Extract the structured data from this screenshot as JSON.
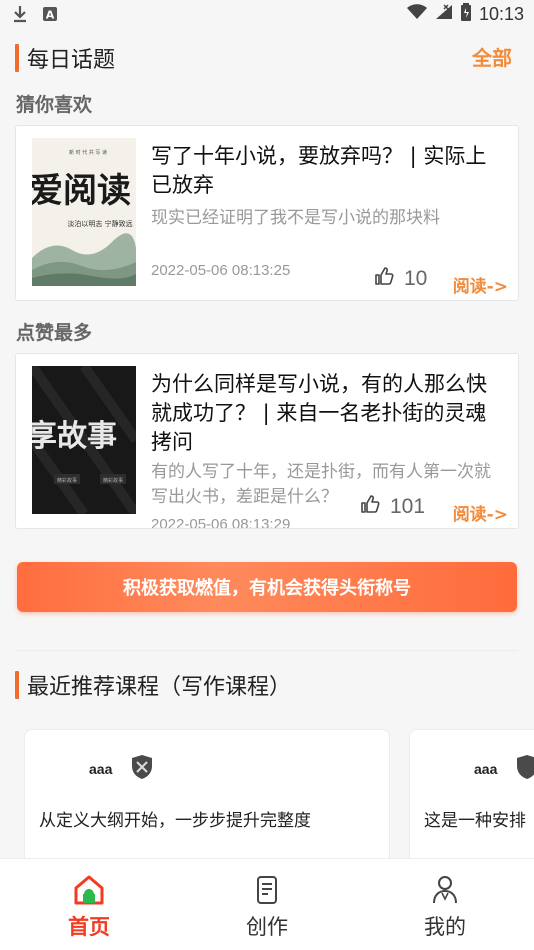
{
  "status_bar": {
    "time": "10:13"
  },
  "daily": {
    "title": "每日话题",
    "more_label": "全部"
  },
  "guess": {
    "label": "猜你喜欢",
    "title": "写了十年小说，要放弃吗？ | 实际上已放弃",
    "summary": "现实已经证明了我不是写小说的那块料",
    "date": "2022-05-06 08:13:25",
    "likes": "10",
    "read_label": "阅读->",
    "thumb": {
      "big_text": "爱阅读",
      "top_text": "新 时 代  共 写 读",
      "sub_text": "淡泊以明志  宁静致远"
    }
  },
  "top": {
    "label": "点赞最多",
    "title": "为什么同样是写小说，有的人那么快就成功了？ | 来自一名老扑街的灵魂拷问",
    "summary": "有的人写了十年，还是扑街，而有人第一次就写出火书，差距是什么？",
    "date": "2022-05-06 08:13:29",
    "likes": "101",
    "read_label": "阅读->",
    "thumb": {
      "big_text": "享故事",
      "tag1": "精彩故事",
      "tag2": "精彩故事"
    }
  },
  "banner_text": "积极获取燃值，有机会获得头衔称号",
  "courses": {
    "title": "最近推荐课程（写作课程）",
    "items": [
      {
        "name": "aaa",
        "description": "从定义大纲开始，一步步提升完整度"
      },
      {
        "name": "aaa",
        "description": "这是一种安排"
      }
    ]
  },
  "tabs": [
    {
      "label": "首页"
    },
    {
      "label": "创作"
    },
    {
      "label": "我的"
    }
  ],
  "colors": {
    "accent": "#f26b2e",
    "link": "#f28b3a",
    "tab_active": "#f23b1f"
  }
}
